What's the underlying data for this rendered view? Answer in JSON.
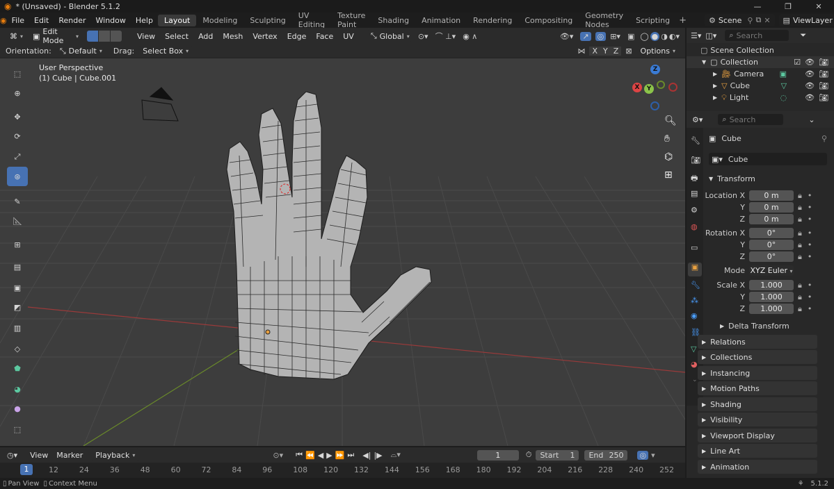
{
  "window": {
    "title": "* (Unsaved) - Blender 5.1.2"
  },
  "topmenu": [
    "File",
    "Edit",
    "Render",
    "Window",
    "Help"
  ],
  "workspaces": [
    {
      "label": "Layout",
      "active": true
    },
    {
      "label": "Modeling"
    },
    {
      "label": "Sculpting"
    },
    {
      "label": "UV Editing"
    },
    {
      "label": "Texture Paint"
    },
    {
      "label": "Shading"
    },
    {
      "label": "Animation"
    },
    {
      "label": "Rendering"
    },
    {
      "label": "Compositing"
    },
    {
      "label": "Geometry Nodes"
    },
    {
      "label": "Scripting"
    }
  ],
  "scene": {
    "name": "Scene",
    "view_layer": "ViewLayer"
  },
  "viewport_header": {
    "mode": "Edit Mode",
    "menus": [
      "View",
      "Select",
      "Add",
      "Mesh",
      "Vertex",
      "Edge",
      "Face",
      "UV"
    ],
    "orientation": "Global"
  },
  "tool_header": {
    "orientation_label": "Orientation:",
    "orientation_value": "Default",
    "drag_label": "Drag:",
    "drag_value": "Select Box",
    "options": "Options",
    "axes": [
      "X",
      "Y",
      "Z"
    ]
  },
  "viewport": {
    "view_name": "User Perspective",
    "object_info": "(1) Cube | Cube.001"
  },
  "gizmo": {
    "x": "X",
    "y": "Y",
    "z": "Z"
  },
  "outliner": {
    "search_placeholder": "Search",
    "root": "Scene Collection",
    "collection": "Collection",
    "items": [
      "Camera",
      "Cube",
      "Light"
    ]
  },
  "properties": {
    "search_placeholder": "Search",
    "object_name": "Cube",
    "data_name": "Cube",
    "transform_title": "Transform",
    "location": {
      "label": "Location X",
      "x": "0 m",
      "y": "0 m",
      "z": "0 m"
    },
    "rotation": {
      "label": "Rotation X",
      "x": "0°",
      "y": "0°",
      "z": "0°"
    },
    "mode": {
      "label": "Mode",
      "value": "XYZ Euler"
    },
    "scale": {
      "label": "Scale X",
      "x": "1.000",
      "y": "1.000",
      "z": "1.000"
    },
    "axis_y": "Y",
    "axis_z": "Z",
    "delta": "Delta Transform",
    "panels": [
      "Relations",
      "Collections",
      "Instancing",
      "Motion Paths",
      "Shading",
      "Visibility",
      "Viewport Display",
      "Line Art",
      "Animation"
    ]
  },
  "timeline": {
    "menus": [
      "View",
      "Marker",
      "Playback"
    ],
    "current_frame": "1",
    "start_label": "Start",
    "start": "1",
    "end_label": "End",
    "end": "250",
    "ticks": [
      "1",
      "12",
      "24",
      "36",
      "48",
      "60",
      "72",
      "84",
      "96",
      "108",
      "120",
      "132",
      "144",
      "156",
      "168",
      "180",
      "192",
      "204",
      "216",
      "228",
      "240",
      "252"
    ]
  },
  "statusbar": {
    "left1": "Pan View",
    "left2": "Context Menu",
    "version": "5.1.2"
  }
}
